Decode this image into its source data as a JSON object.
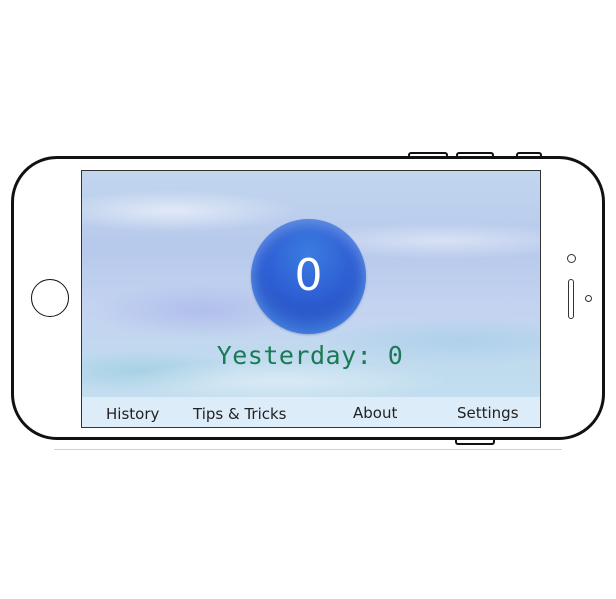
{
  "counter": {
    "value": "0"
  },
  "yesterday": {
    "text": "Yesterday: 0"
  },
  "tabbar": {
    "items": [
      {
        "label": "History"
      },
      {
        "label": "Tips & Tricks"
      },
      {
        "label": "About"
      },
      {
        "label": "Settings"
      }
    ]
  },
  "colors": {
    "counter_circle": "#2f5fd4",
    "yesterday_text": "#1a7a55",
    "tabbar_background": "#e1eefa"
  }
}
